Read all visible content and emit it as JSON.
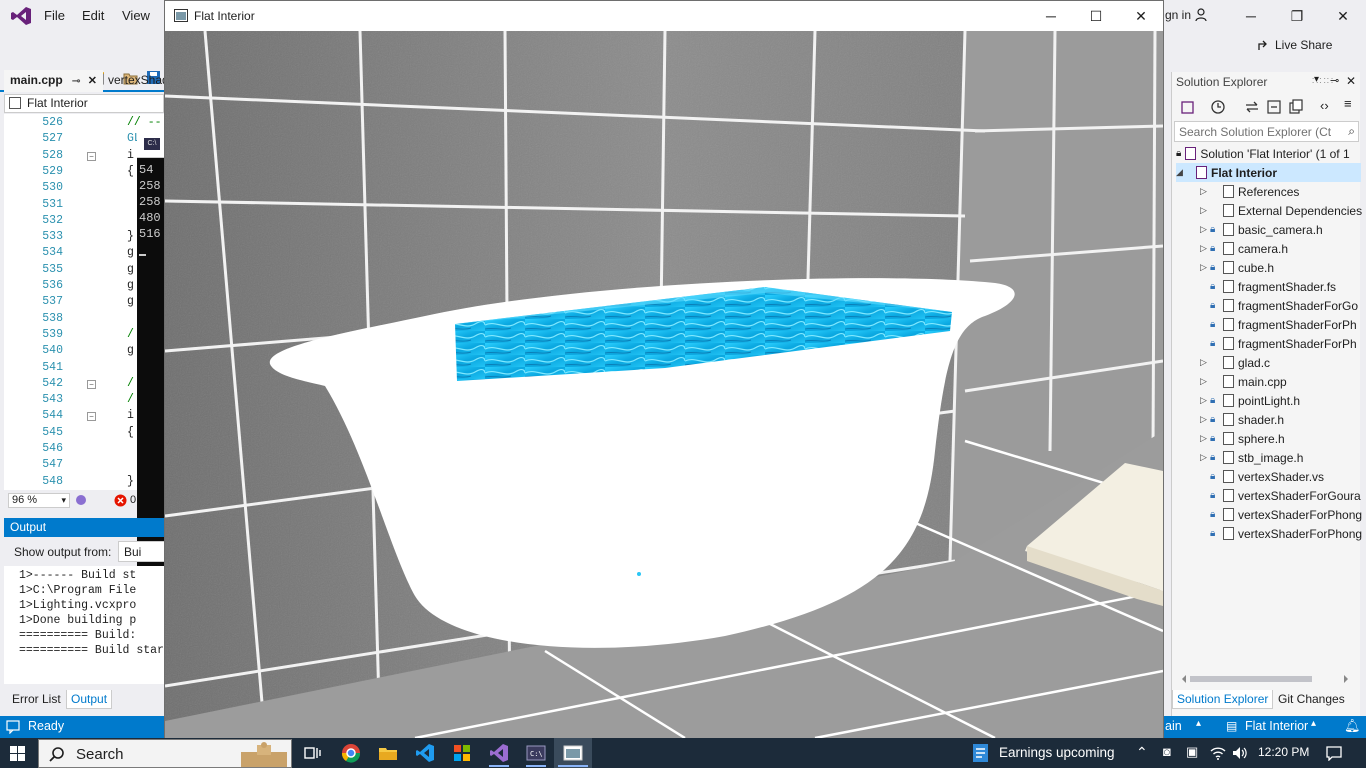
{
  "vs": {
    "menu": [
      "File",
      "Edit",
      "View"
    ],
    "sign_in": "gn in",
    "live_share": "Live Share",
    "doc_tabs": [
      "main.cpp",
      "vertexShad"
    ],
    "nav_scope": "Flat Interior",
    "line_numbers": [
      "526",
      "527",
      "528",
      "529",
      "530",
      "531",
      "532",
      "533",
      "534",
      "535",
      "536",
      "537",
      "538",
      "539",
      "540",
      "541",
      "542",
      "543",
      "544",
      "545",
      "546",
      "547",
      "548"
    ],
    "code_fragments": [
      {
        "line": "526",
        "text": "// --"
      },
      {
        "line": "527",
        "text": "GL"
      },
      {
        "line": "528",
        "text": "i"
      },
      {
        "line": "529",
        "text": "{"
      },
      {
        "line": "533",
        "text": "}"
      },
      {
        "line": "534",
        "text": "g"
      },
      {
        "line": "535",
        "text": "g"
      },
      {
        "line": "536",
        "text": "g"
      },
      {
        "line": "537",
        "text": "g"
      },
      {
        "line": "539",
        "text": "/"
      },
      {
        "line": "540",
        "text": "g"
      },
      {
        "line": "542",
        "text": "/"
      },
      {
        "line": "543",
        "text": "/"
      },
      {
        "line": "544",
        "text": "i"
      },
      {
        "line": "545",
        "text": "{"
      },
      {
        "line": "548",
        "text": "}"
      }
    ],
    "zoom": "96 %",
    "error_count": "0",
    "console_lines": [
      "54",
      "258",
      "258",
      "480",
      "516"
    ],
    "output": {
      "title": "Output",
      "show_from_label": "Show output from:",
      "show_from_value": "Bui",
      "lines": [
        "1>------ Build st",
        "1>C:\\Program File",
        "1>Lighting.vcxpro",
        "1>Done building p",
        "========== Build:",
        "========== Build star"
      ]
    },
    "bottom_tabs": [
      "Error List",
      "Output"
    ],
    "status": {
      "ready": "Ready",
      "branch": "ain",
      "project": "Flat Interior"
    },
    "solution_explorer": {
      "title": "Solution Explorer",
      "search_placeholder": "Search Solution Explorer (Ct",
      "solution": "Solution 'Flat Interior' (1 of 1",
      "project": "Flat Interior",
      "items": [
        {
          "label": "References",
          "expandable": true,
          "lock": false
        },
        {
          "label": "External Dependencies",
          "expandable": true,
          "lock": false
        },
        {
          "label": "basic_camera.h",
          "expandable": true,
          "lock": true
        },
        {
          "label": "camera.h",
          "expandable": true,
          "lock": true
        },
        {
          "label": "cube.h",
          "expandable": true,
          "lock": true
        },
        {
          "label": "fragmentShader.fs",
          "expandable": false,
          "lock": true
        },
        {
          "label": "fragmentShaderForGo",
          "expandable": false,
          "lock": true
        },
        {
          "label": "fragmentShaderForPh",
          "expandable": false,
          "lock": true
        },
        {
          "label": "fragmentShaderForPh",
          "expandable": false,
          "lock": true
        },
        {
          "label": "glad.c",
          "expandable": true,
          "lock": false
        },
        {
          "label": "main.cpp",
          "expandable": true,
          "lock": false
        },
        {
          "label": "pointLight.h",
          "expandable": true,
          "lock": true
        },
        {
          "label": "shader.h",
          "expandable": true,
          "lock": true
        },
        {
          "label": "sphere.h",
          "expandable": true,
          "lock": true
        },
        {
          "label": "stb_image.h",
          "expandable": true,
          "lock": true
        },
        {
          "label": "vertexShader.vs",
          "expandable": false,
          "lock": true
        },
        {
          "label": "vertexShaderForGoura",
          "expandable": false,
          "lock": true
        },
        {
          "label": "vertexShaderForPhong",
          "expandable": false,
          "lock": true
        },
        {
          "label": "vertexShaderForPhong",
          "expandable": false,
          "lock": true
        }
      ],
      "tabs": [
        "Solution Explorer",
        "Git Changes"
      ]
    }
  },
  "flat_interior": {
    "title": "Flat Interior",
    "colors": {
      "tile": "#8a8a8a",
      "grout": "#ffffff",
      "tub": "#ffffff",
      "water": "#18b6e6"
    }
  },
  "taskbar": {
    "search": "Search",
    "news": "Earnings upcoming",
    "clock": "12:20 PM"
  }
}
